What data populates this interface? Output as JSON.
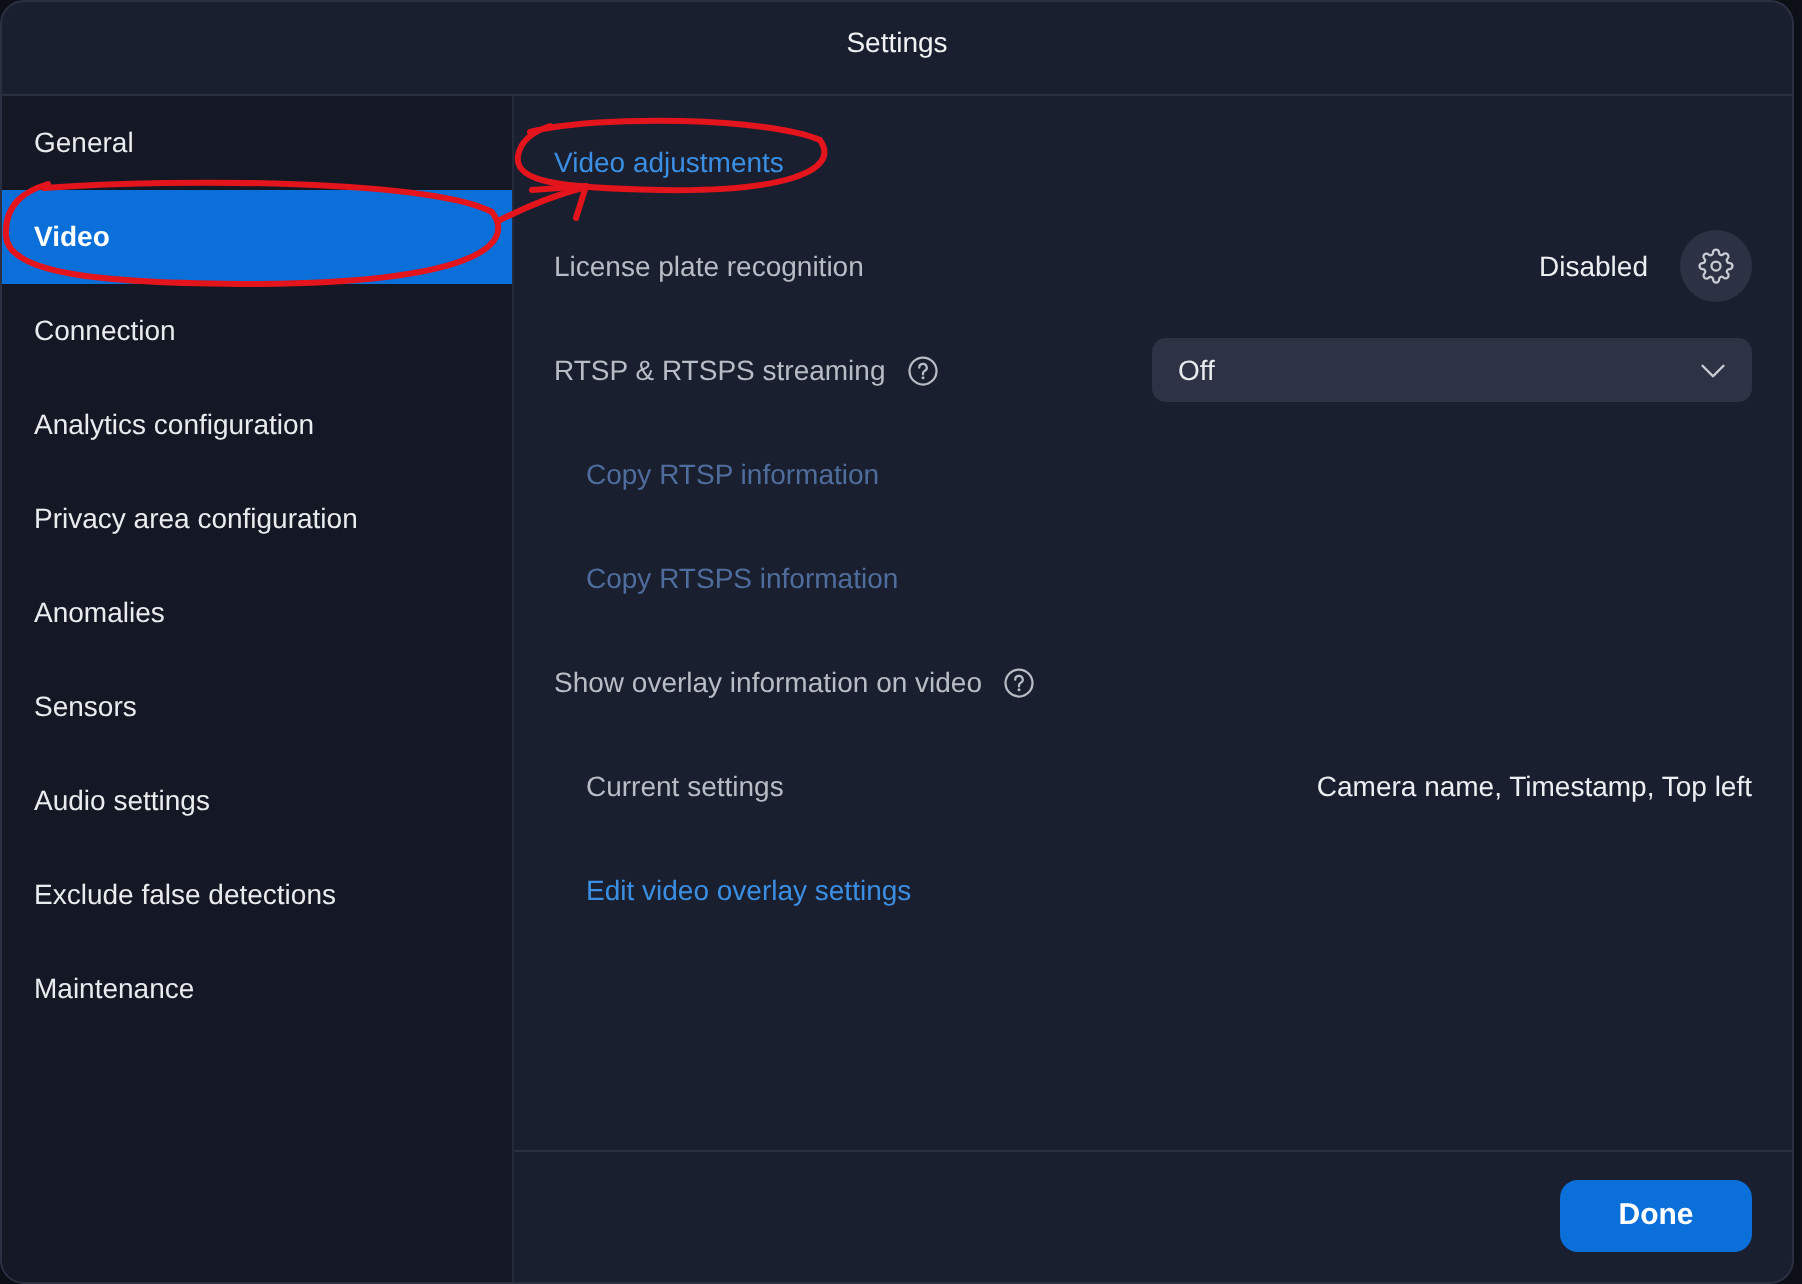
{
  "window": {
    "title": "Settings"
  },
  "sidebar": {
    "items": [
      {
        "label": "General",
        "selected": false
      },
      {
        "label": "Video",
        "selected": true
      },
      {
        "label": "Connection",
        "selected": false
      },
      {
        "label": "Analytics configuration",
        "selected": false
      },
      {
        "label": "Privacy area configuration",
        "selected": false
      },
      {
        "label": "Anomalies",
        "selected": false
      },
      {
        "label": "Sensors",
        "selected": false
      },
      {
        "label": "Audio settings",
        "selected": false
      },
      {
        "label": "Exclude false detections",
        "selected": false
      },
      {
        "label": "Maintenance",
        "selected": false
      }
    ]
  },
  "content": {
    "rows": [
      {
        "kind": "link",
        "label": "Video adjustments",
        "disabled": false,
        "help": false
      },
      {
        "kind": "status",
        "label": "License plate recognition",
        "value": "Disabled",
        "help": false
      },
      {
        "kind": "select",
        "label": "RTSP & RTSPS streaming",
        "value": "Off",
        "help": true,
        "children": [
          {
            "kind": "link",
            "label": "Copy RTSP information",
            "disabled": true
          },
          {
            "kind": "link",
            "label": "Copy RTSPS information",
            "disabled": true
          }
        ]
      },
      {
        "kind": "heading",
        "label": "Show overlay information on video",
        "help": true,
        "children": [
          {
            "kind": "info",
            "label": "Current settings",
            "value": "Camera name, Timestamp, Top left"
          },
          {
            "kind": "link",
            "label": "Edit video overlay settings",
            "disabled": false
          }
        ]
      }
    ]
  },
  "footer": {
    "buttons": [
      {
        "label": "Done"
      }
    ]
  }
}
